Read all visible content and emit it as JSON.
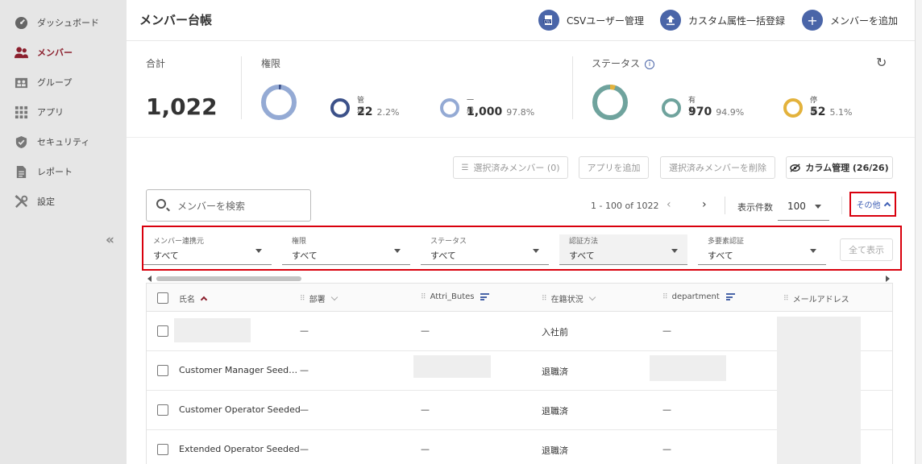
{
  "sidebar": {
    "items": [
      {
        "label": "ダッシュボード",
        "icon": "dashboard-icon"
      },
      {
        "label": "メンバー",
        "icon": "members-icon",
        "active": true
      },
      {
        "label": "グループ",
        "icon": "group-icon"
      },
      {
        "label": "アプリ",
        "icon": "apps-grid-icon"
      },
      {
        "label": "セキュリティ",
        "icon": "shield-icon"
      },
      {
        "label": "レポート",
        "icon": "report-icon"
      },
      {
        "label": "設定",
        "icon": "settings-tools-icon"
      }
    ],
    "collapse_label": "«"
  },
  "header": {
    "title": "メンバー台帳",
    "csv_label": "CSVユーザー管理",
    "custom_attr_label": "カスタム属性一括登録",
    "add_member_label": "メンバーを追加"
  },
  "stats": {
    "total_label": "合計",
    "total_value": "1,022",
    "role_label": "権限",
    "admin": {
      "label": "管理",
      "value": "22",
      "pct": "2.2%"
    },
    "general": {
      "label": "一般",
      "value": "1,000",
      "pct": "97.8%"
    },
    "status_label": "ステータス",
    "active": {
      "label": "有効",
      "value": "970",
      "pct": "94.9%"
    },
    "stopped": {
      "label": "停止",
      "value": "52",
      "pct": "5.1%"
    },
    "admin_fraction": 0.022,
    "stopped_fraction": 0.051
  },
  "actions": {
    "selected_members": "選択済みメンバー (0)",
    "add_app": "アプリを追加",
    "delete_selected": "選択済みメンバーを削除",
    "column_manage": "カラム管理 (26/26)"
  },
  "search": {
    "placeholder": "メンバーを検索"
  },
  "pagination": {
    "range": "1 - 100 of 1022",
    "per_page_label": "表示件数",
    "per_page_value": "100",
    "more_label": "その他"
  },
  "filters": [
    {
      "label": "メンバー連携元",
      "value": "すべて"
    },
    {
      "label": "権限",
      "value": "すべて"
    },
    {
      "label": "ステータス",
      "value": "すべて"
    },
    {
      "label": "認証方法",
      "value": "すべて"
    },
    {
      "label": "多要素認証",
      "value": "すべて"
    }
  ],
  "show_all_label": "全て表示",
  "table": {
    "columns": [
      "氏名",
      "部署",
      "Attri_Butes",
      "在籍状況",
      "department",
      "メールアドレス"
    ],
    "rows": [
      {
        "name": "",
        "dept": "—",
        "attr": "—",
        "status": "入社前",
        "department": "—"
      },
      {
        "name": "Customer Manager Seed…",
        "dept": "—",
        "attr": "",
        "status": "退職済",
        "department": ""
      },
      {
        "name": "Customer Operator Seeded",
        "dept": "—",
        "attr": "—",
        "status": "退職済",
        "department": "—"
      },
      {
        "name": "Extended Operator Seeded",
        "dept": "—",
        "attr": "—",
        "status": "退職済",
        "department": "—"
      }
    ]
  },
  "colors": {
    "accent": "#4a65a8",
    "admin_ring": "#3c5189",
    "general_ring": "#94aad4",
    "active_ring": "#6fa39d",
    "stopped_ring": "#e3b23c",
    "highlight": "#d9000d"
  }
}
